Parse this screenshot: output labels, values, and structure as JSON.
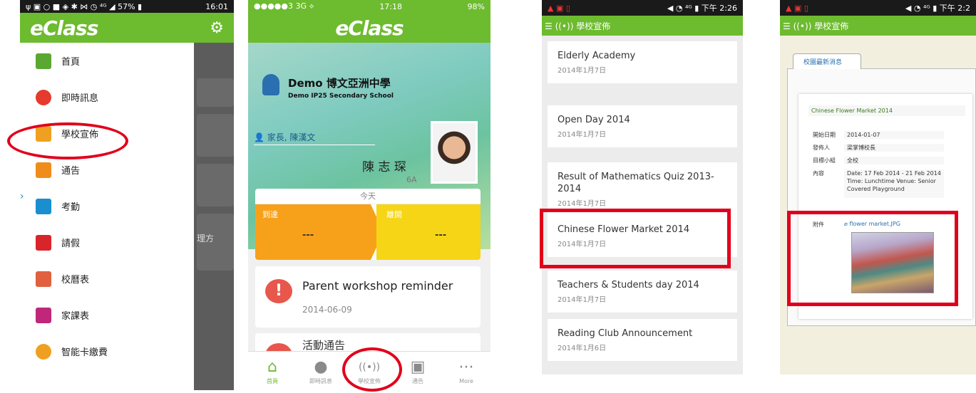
{
  "screen1": {
    "status": {
      "left": "ψ ▣ ○ ■   ◈ ✱ ⋈ ◷ ⁴ᴳ ◢ 57% ▮",
      "time": "16:01"
    },
    "logo": "eClass",
    "menu": [
      {
        "label": "首頁",
        "icon": "home-icon",
        "color": "#5aa832"
      },
      {
        "label": "即時訊息",
        "icon": "message-bubble-icon",
        "color": "#e53a2e"
      },
      {
        "label": "學校宣佈",
        "icon": "broadcast-icon",
        "color": "#f0a020"
      },
      {
        "label": "通告",
        "icon": "notice-icon",
        "color": "#f08c1c"
      },
      {
        "label": "考勤",
        "icon": "attendance-arrows-icon",
        "color": "#1a8ecf"
      },
      {
        "label": "請假",
        "icon": "leave-icon",
        "color": "#d9252a"
      },
      {
        "label": "校曆表",
        "icon": "calendar-icon",
        "color": "#e06040"
      },
      {
        "label": "家課表",
        "icon": "homework-icon",
        "color": "#c0277a"
      },
      {
        "label": "智能卡繳費",
        "icon": "payment-coin-icon",
        "color": "#f0a020"
      }
    ],
    "behind_text": "理方"
  },
  "screen2": {
    "status": {
      "left": "●●●●●3  3G ⟡",
      "time": "17:18",
      "battery": "98%"
    },
    "logo": "eClass",
    "school_name": "Demo 博文亞洲中學",
    "school_en": "Demo IP25 Secondary School",
    "parent_label": "家長, 陳漢文",
    "student_name": "陳 志 琛",
    "student_class": "6A",
    "today_label": "今天",
    "arrive_label": "到達",
    "arrive_value": "---",
    "leave_label": "離開",
    "leave_value": "---",
    "notice_title": "Parent workshop reminder",
    "notice_date": "2014-06-09",
    "next_card_text": "活動通告",
    "tabs": [
      {
        "label": "首頁",
        "icon": "home-icon",
        "active": true
      },
      {
        "label": "即時訊息",
        "icon": "message-bubble-icon"
      },
      {
        "label": "學校宣佈",
        "icon": "broadcast-icon"
      },
      {
        "label": "通告",
        "icon": "notice-icon"
      },
      {
        "label": "More",
        "icon": "more-dots-icon"
      }
    ]
  },
  "screen3": {
    "status": {
      "left": "▲ ▣ ▯",
      "right": "◀ ◔ ⁴ᴳ ▮ 下午 2:26"
    },
    "header": "☰ ((•)) 學校宣佈",
    "items": [
      {
        "title": "Elderly Academy",
        "date": "2014年1月7日"
      },
      {
        "title": "Open Day 2014",
        "date": "2014年1月7日"
      },
      {
        "title": "Result of Mathematics Quiz 2013-2014",
        "date": "2014年1月7日"
      },
      {
        "title": "Chinese Flower Market 2014",
        "date": "2014年1月7日"
      },
      {
        "title": "Teachers & Students day 2014",
        "date": "2014年1月7日"
      },
      {
        "title": "Reading Club Announcement",
        "date": "2014年1月6日"
      }
    ]
  },
  "screen4": {
    "status": {
      "left": "▲ ▣ ▯",
      "right": "◀ ◔ ⁴ᴳ ▮ 下午 2:2"
    },
    "header": "☰ ((•)) 學校宣佈",
    "tab": "校園最新消息",
    "title": "Chinese Flower Market 2014",
    "fields": [
      {
        "key": "開始日期",
        "value": "2014-01-07"
      },
      {
        "key": "發佈人",
        "value": "梁掌博校長"
      },
      {
        "key": "目標小組",
        "value": "全校"
      },
      {
        "key": "內容",
        "value": "Date: 17 Feb 2014 - 21 Feb 2014 Time: Lunchtime Venue: Senior Covered Playground"
      }
    ],
    "attach_key": "附件",
    "attach_file": "flower market.JPG"
  },
  "colors": {
    "brand_green": "#6dbb2f",
    "highlight_red": "#e1001a"
  }
}
